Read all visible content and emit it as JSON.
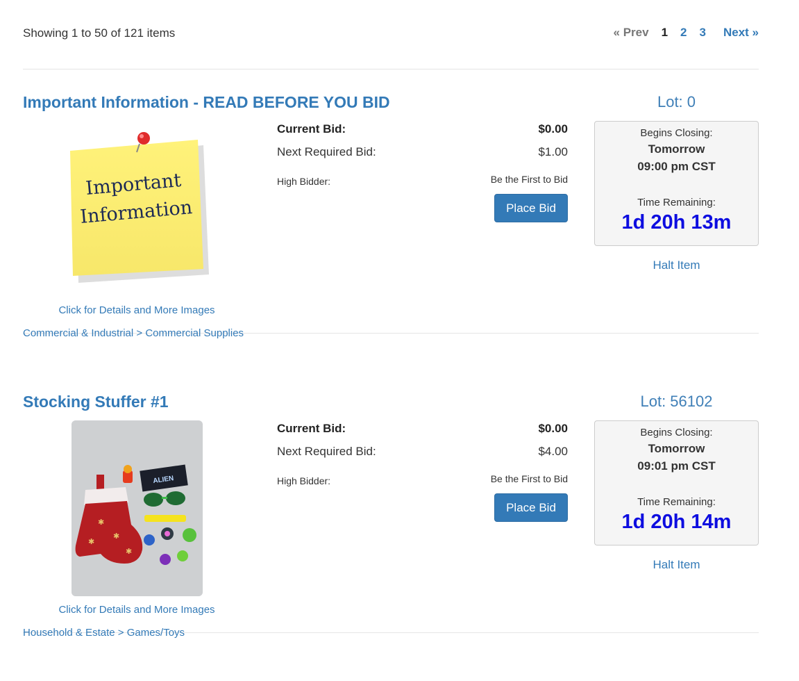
{
  "summary": {
    "showing_text": "Showing 1 to 50 of 121 items"
  },
  "pagination": {
    "prev": "« Prev",
    "current": "1",
    "pages": [
      "2",
      "3"
    ],
    "next": "Next »"
  },
  "items": [
    {
      "title": "Important Information - READ BEFORE YOU BID",
      "lot": "Lot: 0",
      "image_alt": "Important Information",
      "note_text_line1": "Important",
      "note_text_line2": "Information",
      "details_link": "Click for Details and More Images",
      "category_parent": "Commercial & Industrial",
      "category_sep": " > ",
      "category_child": "Commercial Supplies",
      "current_bid_label": "Current Bid:",
      "current_bid": "$0.00",
      "next_bid_label": "Next Required Bid:",
      "next_bid": "$1.00",
      "high_bidder_label": "High Bidder:",
      "high_bidder": "Be the First to Bid",
      "place_bid": "Place Bid",
      "begins_closing_label": "Begins Closing:",
      "closing_day": "Tomorrow",
      "closing_time": "09:00 pm CST",
      "time_remaining_label": "Time Remaining:",
      "time_remaining": "1d 20h 13m",
      "halt": "Halt Item"
    },
    {
      "title": "Stocking Stuffer #1",
      "lot": "Lot: 56102",
      "image_alt": "stocking and toys",
      "image_label": "ALIEN",
      "details_link": "Click for Details and More Images",
      "category_parent": "Household & Estate",
      "category_sep": " > ",
      "category_child": "Games/Toys",
      "current_bid_label": "Current Bid:",
      "current_bid": "$0.00",
      "next_bid_label": "Next Required Bid:",
      "next_bid": "$4.00",
      "high_bidder_label": "High Bidder:",
      "high_bidder": "Be the First to Bid",
      "place_bid": "Place Bid",
      "begins_closing_label": "Begins Closing:",
      "closing_day": "Tomorrow",
      "closing_time": "09:01 pm CST",
      "time_remaining_label": "Time Remaining:",
      "time_remaining": "1d 20h 14m",
      "halt": "Halt Item"
    }
  ]
}
